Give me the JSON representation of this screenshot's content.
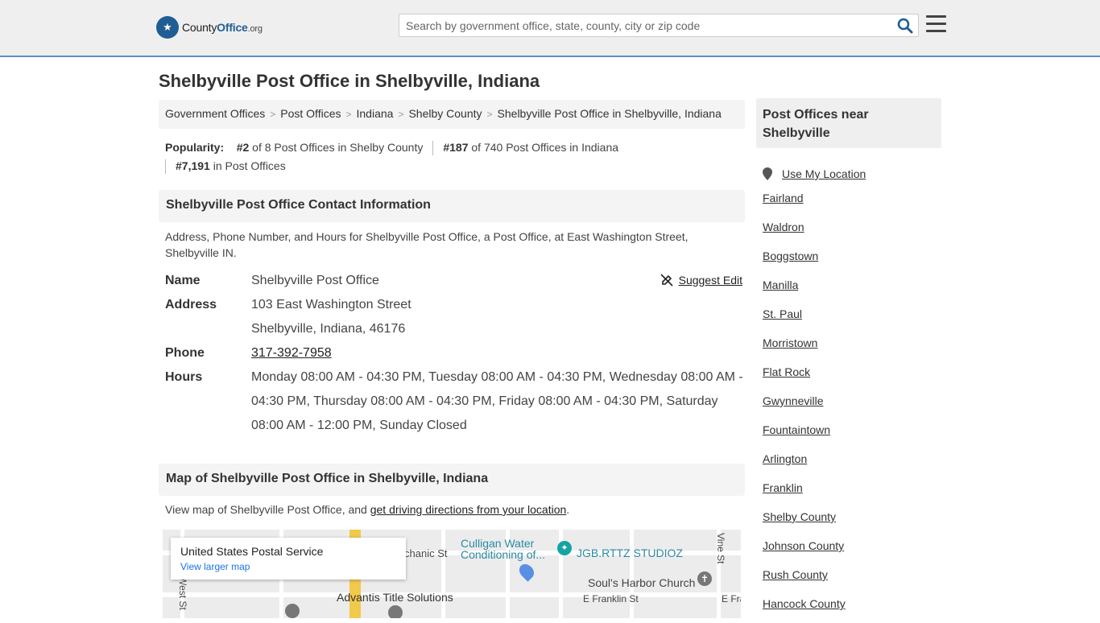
{
  "header": {
    "logo_county": "County",
    "logo_office": "Office",
    "logo_org": ".org",
    "search_placeholder": "Search by government office, state, county, city or zip code"
  },
  "page_title": "Shelbyville Post Office in Shelbyville, Indiana",
  "breadcrumb": [
    "Government Offices",
    "Post Offices",
    "Indiana",
    "Shelby County",
    "Shelbyville Post Office in Shelbyville, Indiana"
  ],
  "popularity": {
    "label": "Popularity:",
    "rank1": "#2",
    "text1": " of 8 Post Offices in Shelby County",
    "rank2": "#187",
    "text2": " of 740 Post Offices in Indiana",
    "rank3": "#7,191",
    "text3": " in Post Offices"
  },
  "contact": {
    "heading": "Shelbyville Post Office Contact Information",
    "description": "Address, Phone Number, and Hours for Shelbyville Post Office, a Post Office, at East Washington Street, Shelbyville IN.",
    "suggest_edit": "Suggest Edit",
    "name_label": "Name",
    "name": "Shelbyville Post Office",
    "address_label": "Address",
    "address_line1": "103 East Washington Street",
    "address_line2": "Shelbyville, Indiana, 46176",
    "phone_label": "Phone",
    "phone": "317-392-7958",
    "hours_label": "Hours",
    "hours": "Monday 08:00 AM - 04:30 PM, Tuesday 08:00 AM - 04:30 PM, Wednesday 08:00 AM - 04:30 PM, Thursday 08:00 AM - 04:30 PM, Friday 08:00 AM - 04:30 PM, Saturday 08:00 AM - 12:00 PM, Sunday Closed"
  },
  "map_section": {
    "heading": "Map of Shelbyville Post Office in Shelbyville, Indiana",
    "desc_prefix": "View map of Shelbyville Post Office, and ",
    "desc_link": "get driving directions from your location",
    "desc_suffix": ".",
    "card_title": "United States Postal Service",
    "card_link": "View larger map",
    "labels": {
      "mechanic": "chanic St",
      "culligan": "Culligan Water",
      "culligan2": "Conditioning of...",
      "jgb": "JGB.RTTZ STUDIOZ",
      "vine": "Vine St",
      "souls": "Soul's Harbor Church",
      "advantis": "Advantis Title Solutions",
      "efranklin": "E Franklin St",
      "efra": "E Fra",
      "west": "West St"
    }
  },
  "sidebar": {
    "heading": "Post Offices near Shelbyville",
    "use_location": "Use My Location",
    "links": [
      "Fairland",
      "Waldron",
      "Boggstown",
      "Manilla",
      "St. Paul",
      "Morristown",
      "Flat Rock",
      "Gwynneville",
      "Fountaintown",
      "Arlington",
      "Franklin",
      "Shelby County",
      "Johnson County",
      "Rush County",
      "Hancock County"
    ]
  }
}
